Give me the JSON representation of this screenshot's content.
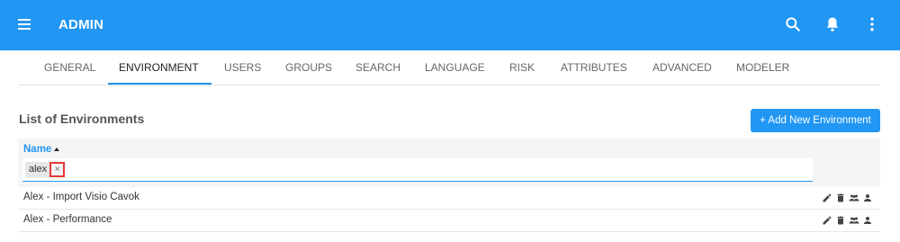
{
  "header": {
    "title": "ADMIN",
    "icons": [
      "menu-icon",
      "search-icon",
      "bell-icon",
      "more-vert-icon"
    ]
  },
  "tabs": [
    {
      "label": "GENERAL"
    },
    {
      "label": "ENVIRONMENT",
      "active": true
    },
    {
      "label": "USERS"
    },
    {
      "label": "GROUPS"
    },
    {
      "label": "SEARCH"
    },
    {
      "label": "LANGUAGE"
    },
    {
      "label": "RISK"
    },
    {
      "label": "ATTRIBUTES"
    },
    {
      "label": "ADVANCED"
    },
    {
      "label": "MODELER"
    }
  ],
  "main": {
    "section_title": "List of Environments",
    "add_button_label": "+ Add New Environment",
    "table": {
      "column_name": "Name",
      "sort": "ascending",
      "filter_chip": "alex",
      "filter_chip_remove": "×",
      "rows": [
        {
          "name": "Alex - Import Visio Cavok",
          "actions": [
            "edit-icon",
            "delete-icon",
            "groups-icon",
            "user-icon"
          ]
        },
        {
          "name": "Alex - Performance",
          "actions": [
            "edit-icon",
            "delete-icon",
            "groups-icon",
            "user-icon"
          ]
        }
      ]
    }
  },
  "colors": {
    "accent": "#2196f3",
    "highlight": "#e53935"
  }
}
